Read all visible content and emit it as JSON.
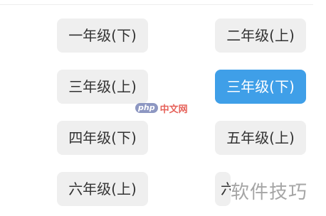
{
  "grades": {
    "items": [
      {
        "label": "一年级(下)"
      },
      {
        "label": "二年级(上)"
      },
      {
        "label": "三年级(上)"
      },
      {
        "label": "三年级(下)",
        "selected": true
      },
      {
        "label": "四年级(下)"
      },
      {
        "label": "五年级(上)"
      },
      {
        "label": "六年级(上)"
      },
      {
        "label": "六年级(下)",
        "partially_visible": true
      }
    ]
  },
  "watermarks": {
    "center_badge": "php",
    "center_text": "中文网",
    "corner_text": "软件技巧"
  },
  "colors": {
    "selected_bg": "#3f9fe8",
    "selected_text": "#ffffff",
    "button_bg": "#efefef",
    "button_text": "#333333"
  }
}
